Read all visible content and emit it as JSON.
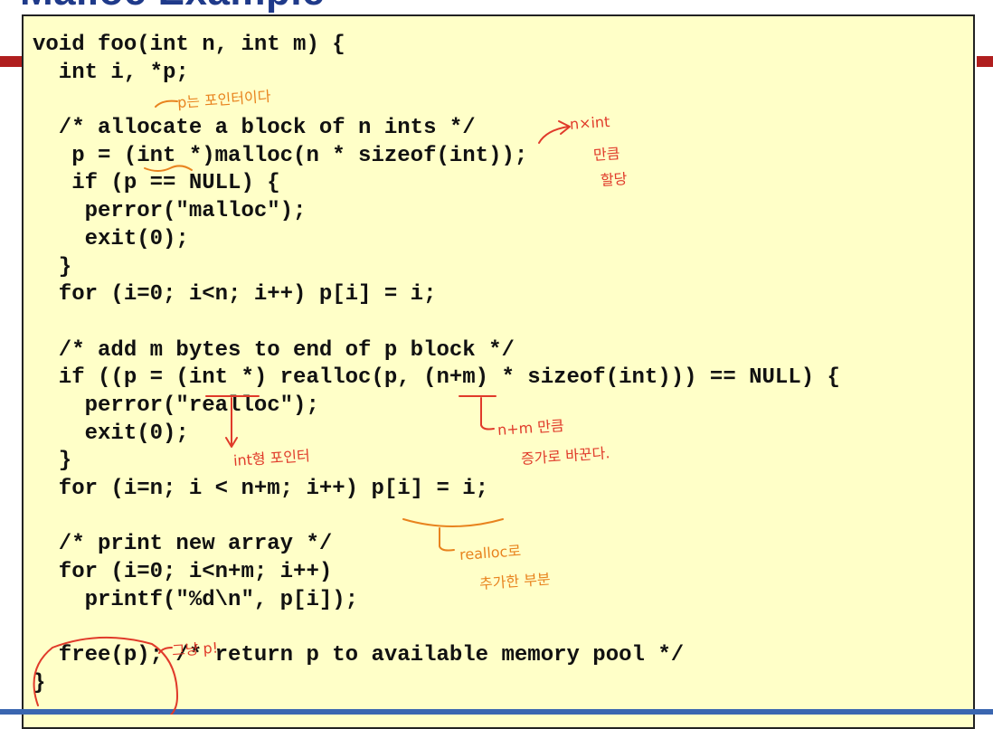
{
  "slide": {
    "title": "Malloc Example"
  },
  "code": {
    "lines": [
      "void foo(int n, int m) {",
      "  int i, *p;",
      "",
      "  /* allocate a block of n ints */",
      "   p = (int *)malloc(n * sizeof(int));",
      "   if (p == NULL) {",
      "    perror(\"malloc\");",
      "    exit(0);",
      "  }",
      "  for (i=0; i<n; i++) p[i] = i;",
      "",
      "  /* add m bytes to end of p block */",
      "  if ((p = (int *) realloc(p, (n+m) * sizeof(int))) == NULL) {",
      "    perror(\"realloc\");",
      "    exit(0);",
      "  }",
      "  for (i=n; i < n+m; i++) p[i] = i;",
      "",
      "  /* print new array */",
      "  for (i=0; i<n+m; i++)",
      "    printf(\"%d\\n\", p[i]);",
      "",
      "  free(p); /* return p to available memory pool */",
      "}"
    ]
  },
  "annotations": {
    "p_is_pointer": "p는 포인터이다",
    "n_times_int": "n×int",
    "amount": "만큼",
    "allocate": "할당",
    "n_plus_m_amount": "n+m 만큼",
    "grow_change": "증가로 바꾼다.",
    "int_pointer": "int형 포인터",
    "realloc_with": "realloc로",
    "added_part": "추가한 부분",
    "just_p": "그냥 p!"
  },
  "colors": {
    "code_background": "#ffffc8",
    "title": "#1f3a8a",
    "accent_red": "#b01e1e",
    "ink_red": "#e03a2a",
    "ink_orange": "#e8831e",
    "bottom_bar": "#3a66b0"
  }
}
